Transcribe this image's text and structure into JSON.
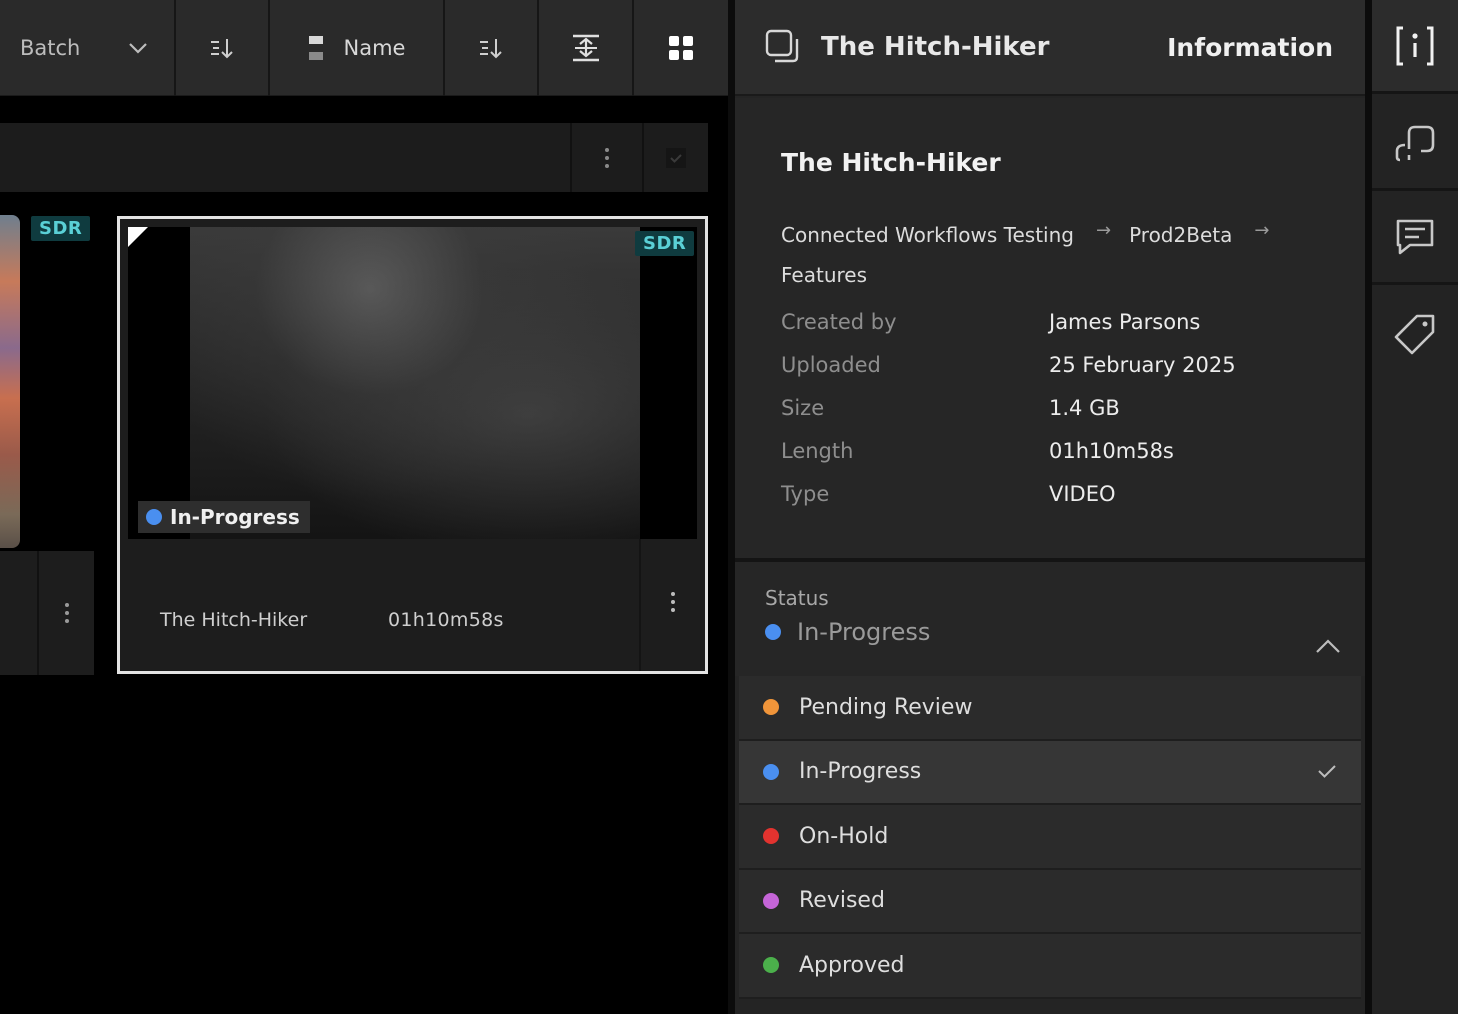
{
  "toolbar": {
    "batch_label": "Batch",
    "name_label": "Name"
  },
  "cards": {
    "partial": {
      "badge": "SDR"
    },
    "selected": {
      "badge": "SDR",
      "status": "In-Progress",
      "title": "The Hitch-Hiker",
      "length": "01h10m58s"
    }
  },
  "info": {
    "header_title": "The Hitch-Hiker",
    "header_section": "Information",
    "title": "The Hitch-Hiker",
    "breadcrumb": [
      "Connected Workflows Testing",
      "Prod2Beta",
      "Features"
    ],
    "breadcrumb_separator": "→",
    "fields": [
      {
        "key": "Created by",
        "value": "James Parsons"
      },
      {
        "key": "Uploaded",
        "value": "25 February 2025"
      },
      {
        "key": "Size",
        "value": "1.4 GB"
      },
      {
        "key": "Length",
        "value": "01h10m58s"
      },
      {
        "key": "Type",
        "value": "VIDEO"
      }
    ],
    "status_label": "Status",
    "status_current": "In-Progress",
    "status_options": [
      {
        "label": "Pending Review",
        "color": "#f0953a",
        "selected": false
      },
      {
        "label": "In-Progress",
        "color": "#4a8ff0",
        "selected": true
      },
      {
        "label": "On-Hold",
        "color": "#e2332f",
        "selected": false
      },
      {
        "label": "Revised",
        "color": "#c565d8",
        "selected": false
      },
      {
        "label": "Approved",
        "color": "#4bb04b",
        "selected": false
      }
    ]
  },
  "colors": {
    "in_progress": "#4a8ff0",
    "sdr_bg": "#0f3b3f",
    "sdr_text": "#5ad0d6"
  },
  "rail": {
    "icons": [
      "info-icon",
      "relink-icon",
      "comments-icon",
      "tag-icon"
    ]
  }
}
